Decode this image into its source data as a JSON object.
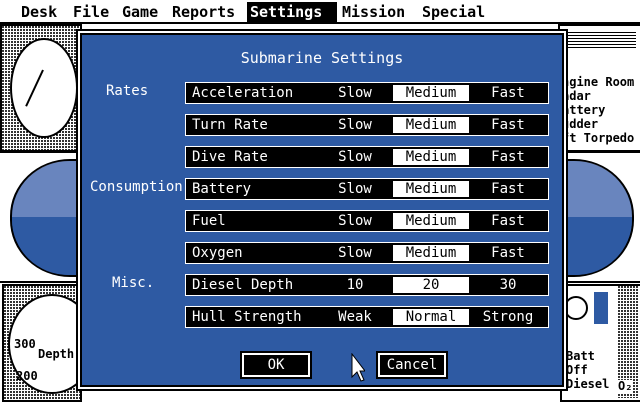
{
  "menubar": {
    "items": [
      "Desk",
      "File",
      "Game",
      "Reports",
      "Settings",
      "Mission",
      "Special"
    ],
    "active": "Settings"
  },
  "background": {
    "right_list": [
      "ngine Room",
      "adar",
      "attery",
      "udder",
      "ft Torpedo"
    ],
    "depth_label": "Depth",
    "depth_300": "300",
    "depth_200": "200",
    "status": [
      "Batt",
      "Off",
      "Diesel"
    ],
    "o2": "O₂"
  },
  "dialog": {
    "title": "Submarine Settings",
    "groups": [
      "Rates",
      "Consumption",
      "Misc."
    ],
    "rows": [
      {
        "label": "Acceleration",
        "options": [
          "Slow",
          "Medium",
          "Fast"
        ],
        "selected": 1
      },
      {
        "label": "Turn Rate",
        "options": [
          "Slow",
          "Medium",
          "Fast"
        ],
        "selected": 1
      },
      {
        "label": "Dive Rate",
        "options": [
          "Slow",
          "Medium",
          "Fast"
        ],
        "selected": 1
      },
      {
        "label": "Battery",
        "options": [
          "Slow",
          "Medium",
          "Fast"
        ],
        "selected": 1
      },
      {
        "label": "Fuel",
        "options": [
          "Slow",
          "Medium",
          "Fast"
        ],
        "selected": 1
      },
      {
        "label": "Oxygen",
        "options": [
          "Slow",
          "Medium",
          "Fast"
        ],
        "selected": 1
      },
      {
        "label": "Diesel Depth",
        "options": [
          "10",
          "20",
          "30"
        ],
        "selected": 1
      },
      {
        "label": "Hull Strength",
        "options": [
          "Weak",
          "Normal",
          "Strong"
        ],
        "selected": 1
      }
    ],
    "ok_label": "OK",
    "cancel_label": "Cancel"
  }
}
